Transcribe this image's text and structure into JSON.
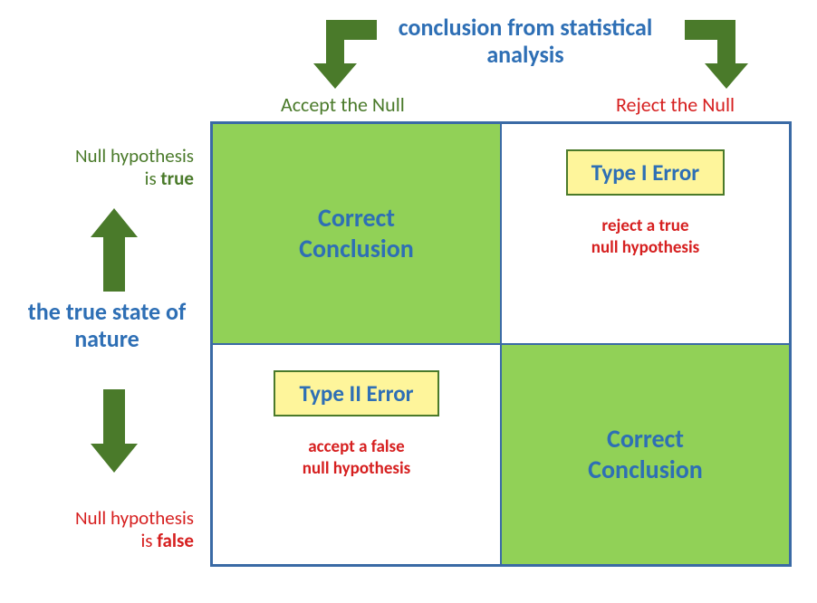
{
  "header_top": "conclusion from statistical analysis",
  "header_side": "the true state of nature",
  "columns": {
    "accept": "Accept the Null",
    "reject": "Reject the Null"
  },
  "rows": {
    "true_line1": "Null hypothesis",
    "true_line2_prefix": "is ",
    "true_line2_bold": "true",
    "false_line1": "Null hypothesis",
    "false_line2_prefix": "is ",
    "false_line2_bold": "false"
  },
  "cells": {
    "correct_label_line1": "Correct",
    "correct_label_line2": "Conclusion",
    "type1_badge": "Type I Error",
    "type1_desc_line1": "reject a true",
    "type1_desc_line2": "null hypothesis",
    "type2_badge": "Type II Error",
    "type2_desc_line1": "accept a false",
    "type2_desc_line2": "null hypothesis"
  },
  "colors": {
    "accent_blue": "#2e6fb5",
    "green_fill": "#91d157",
    "arrow_green": "#4a7a2a",
    "error_red": "#d61f1f",
    "badge_yellow": "#fef59b"
  }
}
